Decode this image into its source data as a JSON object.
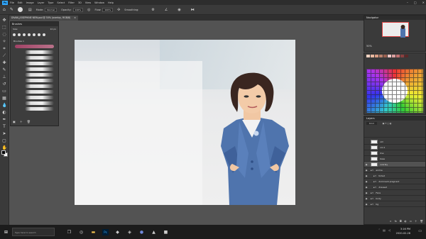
{
  "menu": {
    "app_logo": "Ps",
    "items": [
      "File",
      "Edit",
      "Image",
      "Layer",
      "Type",
      "Select",
      "Filter",
      "3D",
      "View",
      "Window",
      "Help"
    ]
  },
  "options_bar": {
    "mode_label": "Mode:",
    "mode_value": "Normal",
    "opacity_label": "Opacity:",
    "opacity_value": "100%",
    "flow_label": "Flow:",
    "flow_value": "100%",
    "smoothing_label": "Smoothing:"
  },
  "document_tab": {
    "title": "DIVAN_JOSEPHINE NEW.psd @ 50% (overlay, RGB/8)",
    "close": "×"
  },
  "brushes_panel": {
    "title": "Brushes",
    "size_label": "Size:",
    "size_value": "10 px",
    "group_label": "Brushes 1"
  },
  "navigator_panel": {
    "title": "Navigator",
    "zoom": "50%"
  },
  "layers_panel": {
    "title": "Layers",
    "kind_filter": "Kind",
    "layers": [
      {
        "name": "old",
        "visible": false
      },
      {
        "name": "col 2",
        "visible": false
      },
      {
        "name": "line",
        "visible": false
      },
      {
        "name": "base",
        "visible": false
      },
      {
        "name": "overlay",
        "visible": true,
        "selected": true
      },
      {
        "name": "anime",
        "visible": true
      },
      {
        "name": "tinted",
        "visible": true
      },
      {
        "name": "dominant pregnant",
        "visible": true
      },
      {
        "name": "dressed",
        "visible": true
      },
      {
        "name": "Face",
        "visible": true
      },
      {
        "name": "body",
        "visible": true
      },
      {
        "name": "bg",
        "visible": true
      }
    ]
  },
  "taskbar": {
    "search_placeholder": "Type here to search",
    "time": "3:16 PM",
    "date": "2020-02-28"
  },
  "colors": {
    "accent": "#31a8ff",
    "panel": "#3a3a3a",
    "workspace": "#535353"
  }
}
